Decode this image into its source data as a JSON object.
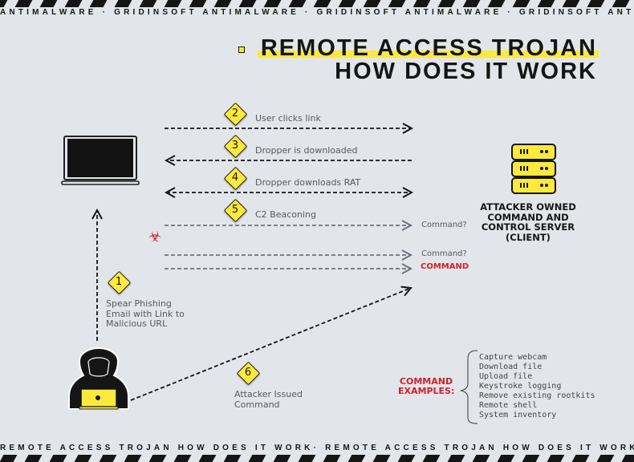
{
  "banner": {
    "top_ticker": "ANTIMALWARE · GRIDINSOFT ANTIMALWARE · GRIDINSOFT ANTIMALWARE · GRIDINSOFT ANTIMALWARE · GRIDINSOFT ANTIMALW",
    "bottom_ticker": "REMOTE ACCESS TROJAN HOW DOES IT WORK· REMOTE ACCESS TROJAN HOW DOES IT WORK REMOTE ACCESS TROJAN"
  },
  "title": {
    "line1": "REMOTE ACCESS TROJAN",
    "line2": "HOW DOES IT WORK"
  },
  "colors": {
    "background": "#e2e6eb",
    "accent_yellow": "#fbe93d",
    "dark": "#151515",
    "alert_red": "#d21f27",
    "beacon_gray": "#6b7480"
  },
  "nodes": {
    "victim": {
      "icon": "laptop-icon"
    },
    "attacker": {
      "icon": "hacker-icon"
    },
    "server": {
      "icon": "server-stack-icon",
      "label": "ATTACKER OWNED COMMAND AND CONTROL SERVER (CLIENT)"
    },
    "infection": {
      "icon": "biohazard-icon",
      "glyph": "☣"
    }
  },
  "steps": [
    {
      "number": "1",
      "label": "Spear Phishing Email with Link to Malicious URL"
    },
    {
      "number": "2",
      "label": "User clicks link"
    },
    {
      "number": "3",
      "label": "Dropper is downloaded"
    },
    {
      "number": "4",
      "label": "Dropper downloads RAT"
    },
    {
      "number": "5",
      "label": "C2 Beaconing"
    },
    {
      "number": "6",
      "label": "Attacker Issued Command"
    }
  ],
  "beacon_responses": [
    {
      "label": "Command?"
    },
    {
      "label": "Command?"
    },
    {
      "label": "COMMAND"
    }
  ],
  "command_examples": {
    "title": "COMMAND EXAMPLES:",
    "items": [
      "Capture webcam",
      "Download file",
      "Upload file",
      "Keystroke logging",
      "Remove existing rootkits",
      "Remote shell",
      "System inventory"
    ]
  }
}
